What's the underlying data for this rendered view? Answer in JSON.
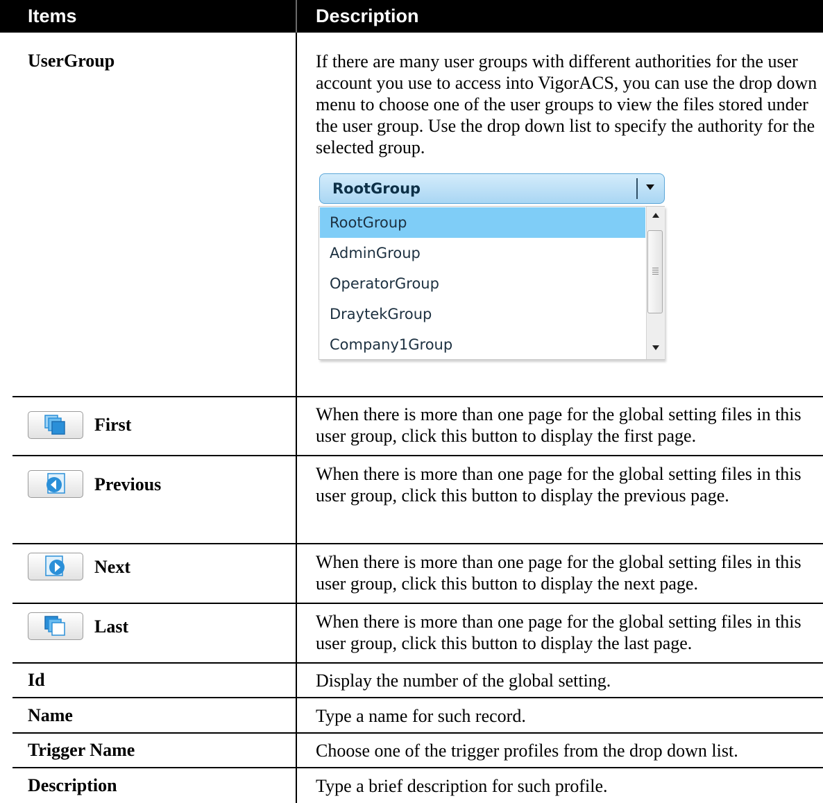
{
  "header": {
    "items": "Items",
    "description": "Description"
  },
  "usergroup": {
    "name": "UserGroup",
    "description": "If there are many user groups with different authorities for the user account you use to access into VigorACS, you can use the drop down menu to choose one of the user groups to view the files stored under the user group. Use the drop down list to specify the authority for the selected group.",
    "dropdown": {
      "selected": "RootGroup",
      "options": [
        "RootGroup",
        "AdminGroup",
        "OperatorGroup",
        "DraytekGroup",
        "Company1Group"
      ]
    }
  },
  "first": {
    "name": "First",
    "icon": "first-page-icon",
    "description": "When there is more than one page for the global setting files in this user group, click this button to display the first page."
  },
  "previous": {
    "name": "Previous",
    "icon": "previous-page-icon",
    "description": "When there is more than one page for the global setting files in this user group, click this button to display the previous page."
  },
  "next": {
    "name": "Next",
    "icon": "next-page-icon",
    "description": "When there is more than one page for the global setting files in this user group, click this button to display the next page."
  },
  "last": {
    "name": "Last",
    "icon": "last-page-icon",
    "description": "When there is more than one page for the global setting files in this user group, click this button to display the last page."
  },
  "id": {
    "name": "Id",
    "description": "Display the number of the global setting."
  },
  "name_row": {
    "name": "Name",
    "description": "Type a name for such record."
  },
  "trigger_name": {
    "name": "Trigger Name",
    "description": "Choose one of the trigger profiles from the drop down list."
  },
  "description_row": {
    "name": "Description",
    "description": "Type a brief description for such profile."
  },
  "colors": {
    "header_bg": "#000000",
    "selected_option": "#7fcdf7",
    "button_icon": "#2a8fd8"
  }
}
